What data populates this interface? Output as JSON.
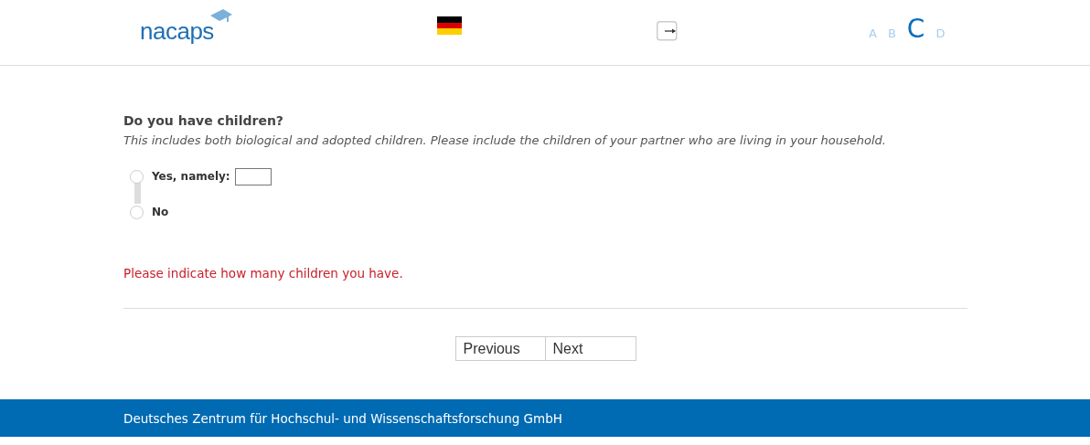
{
  "header": {
    "logo": "nacaps",
    "font_sizes": [
      {
        "label": "A",
        "selected": false
      },
      {
        "label": "B",
        "selected": false
      },
      {
        "label": "C",
        "selected": true
      },
      {
        "label": "D",
        "selected": false
      }
    ]
  },
  "question": {
    "title": "Do you have children?",
    "hint": "This includes both biological and adopted children. Please include the children of your partner who are living in your household.",
    "options": [
      {
        "kind": "text_input",
        "label": "Yes, namely:",
        "selected": false
      },
      {
        "kind": "plain",
        "label": "No",
        "selected": false
      }
    ]
  },
  "error": "Please indicate how many children you have.",
  "buttons": [
    "Previous",
    "Next"
  ],
  "footer": "Deutsches Zentrum für Hochschul- und Wissenschaftsforschung GmbH"
}
